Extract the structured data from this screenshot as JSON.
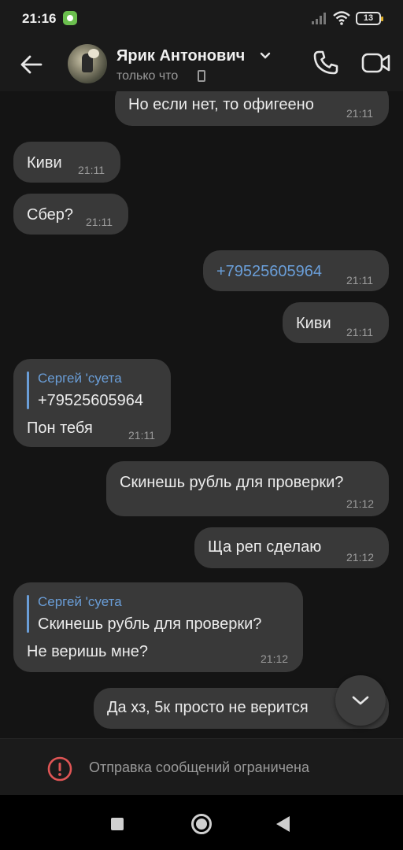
{
  "statusbar": {
    "time": "21:16",
    "battery": "13"
  },
  "header": {
    "name": "Ярик Антонович",
    "status": "только что"
  },
  "messages": [
    {
      "text": "Но если нет, то офигеено",
      "time": "21:11",
      "direction": "out"
    },
    {
      "text": "Киви",
      "time": "21:11",
      "direction": "in"
    },
    {
      "text": "Сбер?",
      "time": "21:11",
      "direction": "in"
    },
    {
      "text": "+79525605964",
      "time": "21:11",
      "direction": "out"
    },
    {
      "text": "Киви",
      "time": "21:11",
      "direction": "out"
    },
    {
      "quote_author": "Сергей 'суета",
      "quote_text": "+79525605964",
      "text": "Пон тебя",
      "time": "21:11",
      "direction": "in"
    },
    {
      "text": "Скинешь рубль для проверки?",
      "time": "21:12",
      "direction": "out"
    },
    {
      "text": "Ща реп сделаю",
      "time": "21:12",
      "direction": "out"
    },
    {
      "quote_author": "Сергей 'суета",
      "quote_text": "Скинешь рубль для проверки?",
      "text": "Не веришь мне?",
      "time": "21:12",
      "direction": "in"
    },
    {
      "text": "Да хз, 5к просто не верится",
      "time": "",
      "direction": "out"
    }
  ],
  "footer": {
    "restricted_message": "Отправка сообщений ограничена"
  },
  "colors": {
    "accent": "#6a9ed8",
    "bubble": "#393939",
    "background": "#141414",
    "warning": "#e05555"
  }
}
